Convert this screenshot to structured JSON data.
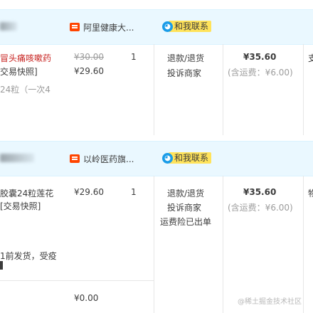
{
  "orders": [
    {
      "shop_name": "阿里健康大...",
      "contact_label": "和我联系",
      "item_title_line1": "冒头痛咳嗽药",
      "item_title_line2": "交易快照]",
      "item_spec": "24粒（一次4",
      "original_price": "¥30.00",
      "price": "¥29.60",
      "quantity": "1",
      "action_refund": "退款/退货",
      "action_complain": "投诉商家",
      "total": "¥35.60",
      "shipping": "(含运费：¥6.00)",
      "right_clip": "支"
    },
    {
      "shop_name": "以岭医药旗...",
      "contact_label": "和我联系",
      "item_title_line1": "胶囊24粒莲花",
      "item_title_line2": "[交易快照]",
      "item_note_line1": "1前发货，受疫",
      "item_note_line2": "",
      "price": "¥29.60",
      "quantity": "1",
      "action_refund": "退款/退货",
      "action_complain": "投诉商家",
      "action_insurance": "运费险已出单",
      "total": "¥35.60",
      "shipping": "(含运费：¥6.00)",
      "right_clip": "物",
      "extra_price": "¥0.00"
    }
  ],
  "watermark": "@稀土掘金技术社区",
  "colors": {
    "header_bg": "#eaf8ff",
    "accent_red": "#c7221f",
    "contact_yellow": "#ffe35b",
    "contact_blue": "#1a9ce8",
    "shop_red": "#ff4400"
  }
}
